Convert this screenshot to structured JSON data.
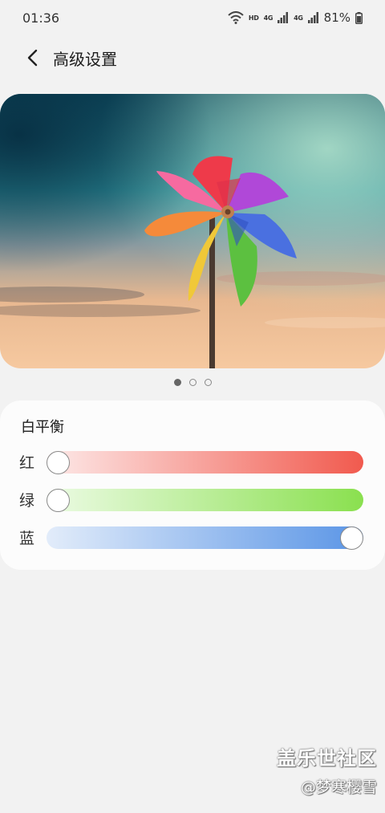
{
  "status_bar": {
    "time": "01:36",
    "hd_label": "HD",
    "net1": "4G",
    "net2": "4G",
    "battery": "81%"
  },
  "header": {
    "title": "高级设置",
    "back_icon": "chevron-left-icon"
  },
  "preview": {
    "image": "pinwheel-photo",
    "pages": 3,
    "active_page": 1
  },
  "white_balance": {
    "title": "白平衡",
    "sliders": [
      {
        "label": "红",
        "value": 0,
        "color": "#f15a4e"
      },
      {
        "label": "绿",
        "value": 0,
        "color": "#8ae04f"
      },
      {
        "label": "蓝",
        "value": 1,
        "color": "#5a95e6"
      }
    ]
  },
  "watermark": {
    "brand": "盖乐世社区",
    "user": "@梦寒樱雪"
  }
}
